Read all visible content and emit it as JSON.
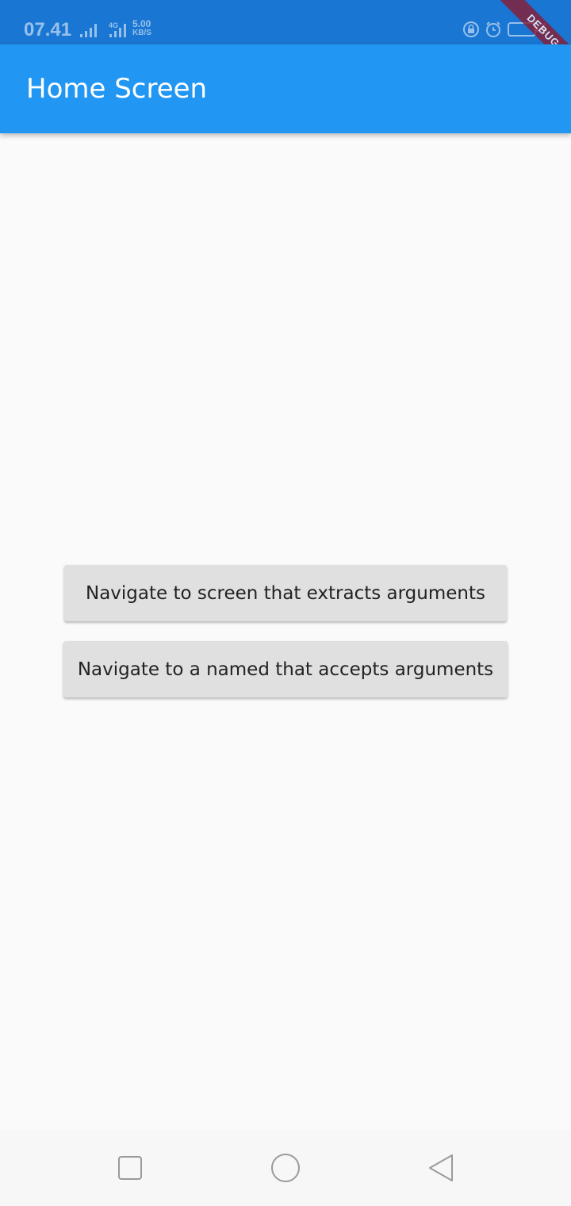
{
  "status_bar": {
    "time": "07.41",
    "network_label": "4G",
    "speed_value": "5.00",
    "speed_unit": "KB/S",
    "icons": [
      "signal-icon",
      "signal-4g-icon",
      "rotation-lock-icon",
      "alarm-icon",
      "battery-charging-icon"
    ]
  },
  "debug_banner": "DEBUG",
  "app_bar": {
    "title": "Home Screen"
  },
  "buttons": {
    "extract_arguments": "Navigate to screen that extracts arguments",
    "accept_arguments": "Navigate to a named that accepts arguments"
  },
  "navigation_bar": {
    "icons": [
      "recents-square-icon",
      "home-circle-icon",
      "back-triangle-icon"
    ]
  },
  "colors": {
    "status_bar": "#1976d2",
    "app_bar": "#2196f3",
    "background": "#fafafa",
    "button": "#e0e0e0",
    "debug_banner": "#8b1c33"
  }
}
